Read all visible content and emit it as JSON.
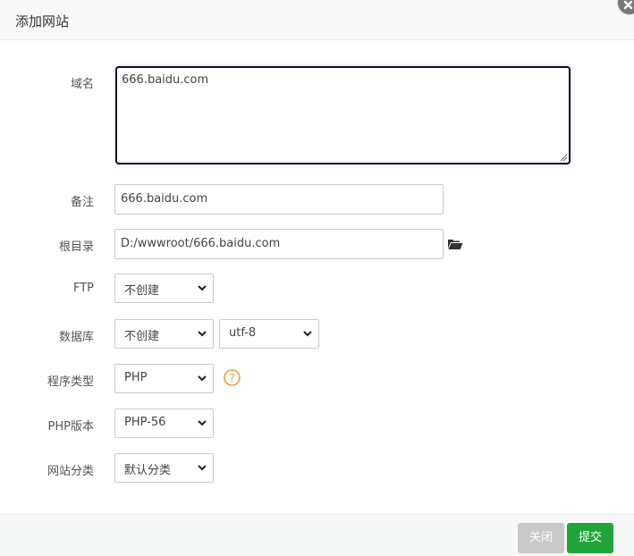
{
  "dialog": {
    "title": "添加网站",
    "close_icon": "close-icon"
  },
  "form": {
    "domain": {
      "label": "域名",
      "value": "666.baidu.com"
    },
    "remark": {
      "label": "备注",
      "value": "666.baidu.com"
    },
    "root_dir": {
      "label": "根目录",
      "value": "D:/wwwroot/666.baidu.com",
      "icon": "folder-open-icon"
    },
    "ftp": {
      "label": "FTP",
      "selected": "不创建"
    },
    "database": {
      "label": "数据库",
      "selected": "不创建",
      "charset_selected": "utf-8"
    },
    "program_type": {
      "label": "程序类型",
      "selected": "PHP",
      "help_icon": "question-circle-icon",
      "help_color": "#e6a23c"
    },
    "php_version": {
      "label": "PHP版本",
      "selected": "PHP-56"
    },
    "site_category": {
      "label": "网站分类",
      "selected": "默认分类"
    }
  },
  "footer": {
    "close_label": "关闭",
    "submit_label": "提交",
    "submit_color": "#20a53a",
    "close_color": "#c9c9c9"
  }
}
